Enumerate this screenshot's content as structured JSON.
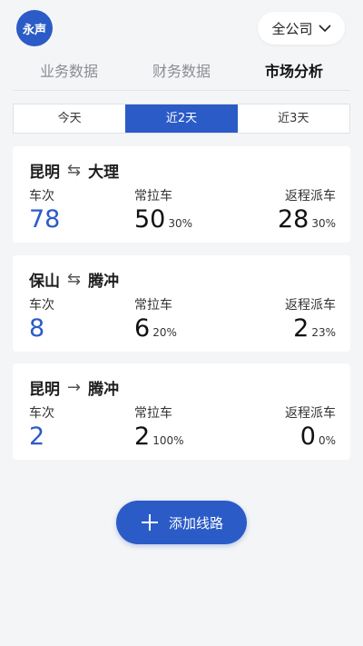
{
  "header": {
    "logo_text": "永声",
    "company_select": "全公司"
  },
  "tabs": [
    {
      "label": "业务数据"
    },
    {
      "label": "财务数据"
    },
    {
      "label": "市场分析"
    }
  ],
  "segments": [
    {
      "label": "今天"
    },
    {
      "label": "近2天"
    },
    {
      "label": "近3天"
    }
  ],
  "routes": [
    {
      "from": "昆明",
      "direction": "⇆",
      "to": "大理",
      "trips_label": "车次",
      "trips": "78",
      "regular_label": "常拉车",
      "regular": "50",
      "regular_pct": "30%",
      "return_label": "返程派车",
      "return": "28",
      "return_pct": "30%"
    },
    {
      "from": "保山",
      "direction": "⇆",
      "to": "腾冲",
      "trips_label": "车次",
      "trips": "8",
      "regular_label": "常拉车",
      "regular": "6",
      "regular_pct": "20%",
      "return_label": "返程派车",
      "return": "2",
      "return_pct": "23%"
    },
    {
      "from": "昆明",
      "direction": "→",
      "to": "腾冲",
      "trips_label": "车次",
      "trips": "2",
      "regular_label": "常拉车",
      "regular": "2",
      "regular_pct": "100%",
      "return_label": "返程派车",
      "return": "0",
      "return_pct": "0%"
    }
  ],
  "add_button": {
    "label": "添加线路",
    "icon": "plus-icon"
  },
  "colors": {
    "accent": "#2b5bc7",
    "background": "#f4f5f7"
  }
}
